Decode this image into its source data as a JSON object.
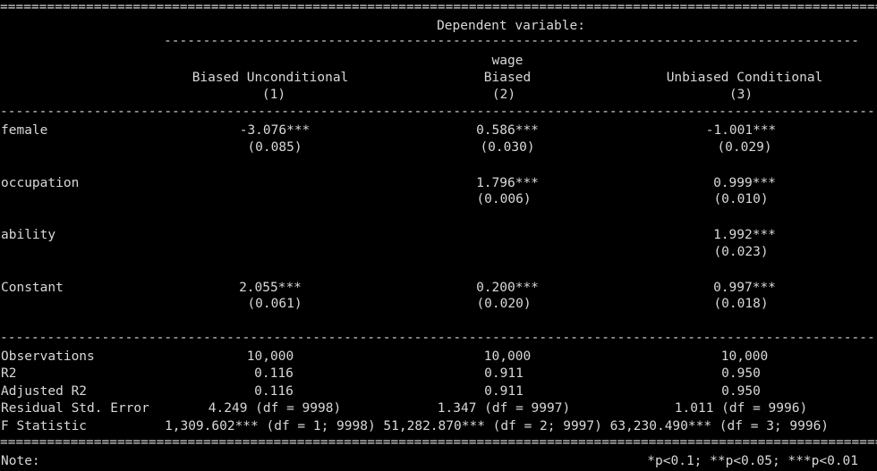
{
  "header": {
    "dependent_label": "Dependent variable:",
    "dep_var": "wage",
    "columns": [
      {
        "name": "Biased Unconditional",
        "number": "(1)"
      },
      {
        "name": "Biased",
        "number": "(2)"
      },
      {
        "name": "Unbiased Conditional",
        "number": "(3)"
      }
    ]
  },
  "coefficients": [
    {
      "label": "female",
      "values": [
        "-3.076***",
        "0.586***",
        "-1.001***"
      ],
      "se": [
        "(0.085)",
        "(0.030)",
        "(0.029)"
      ]
    },
    {
      "label": "occupation",
      "values": [
        "",
        "1.796***",
        "0.999***"
      ],
      "se": [
        "",
        "(0.006)",
        "(0.010)"
      ]
    },
    {
      "label": "ability",
      "values": [
        "",
        "",
        "1.992***"
      ],
      "se": [
        "",
        "",
        "(0.023)"
      ]
    },
    {
      "label": "Constant",
      "values": [
        "2.055***",
        "0.200***",
        "0.997***"
      ],
      "se": [
        "(0.061)",
        "(0.020)",
        "(0.018)"
      ]
    }
  ],
  "stats": [
    {
      "label": "Observations",
      "values": [
        "10,000",
        "10,000",
        "10,000"
      ]
    },
    {
      "label": "R2",
      "values": [
        "0.116",
        "0.911",
        "0.950"
      ]
    },
    {
      "label": "Adjusted R2",
      "values": [
        "0.116",
        "0.911",
        "0.950"
      ]
    },
    {
      "label": "Residual Std. Error",
      "values": [
        "4.249 (df = 9998)",
        "1.347 (df = 9997)",
        "1.011 (df = 9996)"
      ]
    }
  ],
  "fstat": {
    "label": "F Statistic",
    "text": "1,309.602*** (df = 1; 9998) 51,282.870*** (df = 2; 9997) 63,230.490*** (df = 3; 9996)"
  },
  "note": {
    "label": "Note:",
    "text": "*p<0.1; **p<0.05; ***p<0.01"
  }
}
